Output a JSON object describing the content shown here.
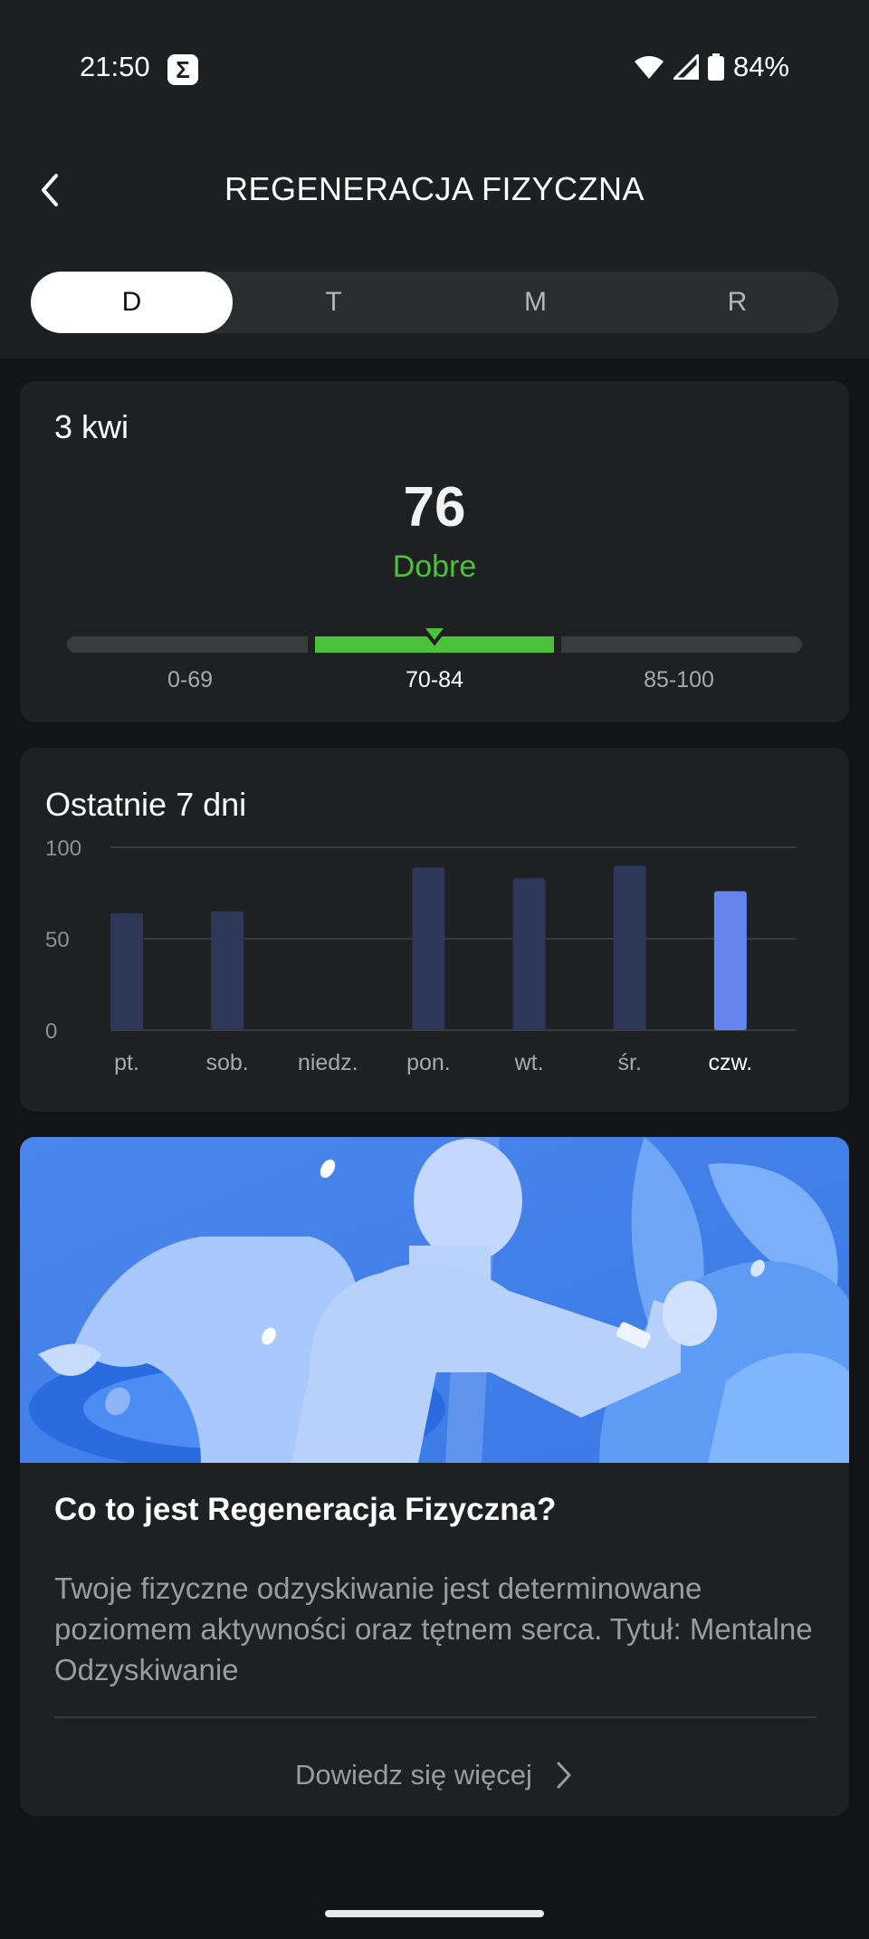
{
  "status_bar": {
    "time": "21:50",
    "app_icon": "sigma-icon",
    "battery_percent": "84%"
  },
  "header": {
    "title": "REGENERACJA FIZYCZNA",
    "back_icon": "chevron-left-icon"
  },
  "period_tabs": {
    "items": [
      {
        "label": "D",
        "active": true
      },
      {
        "label": "T",
        "active": false
      },
      {
        "label": "M",
        "active": false
      },
      {
        "label": "R",
        "active": false
      }
    ]
  },
  "score_card": {
    "date": "3 kwi",
    "score": "76",
    "rating": "Dobre",
    "rating_color": "#4cc13a",
    "ranges": [
      {
        "label": "0-69",
        "active": false
      },
      {
        "label": "70-84",
        "active": true
      },
      {
        "label": "85-100",
        "active": false
      }
    ]
  },
  "history_card": {
    "title": "Ostatnie 7 dni"
  },
  "chart_data": {
    "type": "bar",
    "title": "Ostatnie 7 dni",
    "categories": [
      "pt.",
      "sob.",
      "niedz.",
      "pon.",
      "wt.",
      "śr.",
      "czw."
    ],
    "values": [
      64,
      65,
      null,
      89,
      83,
      90,
      76
    ],
    "highlight_index": 6,
    "ylim": [
      0,
      100
    ],
    "yticks": [
      "100",
      "50",
      "0"
    ],
    "grid": true,
    "colors": {
      "bar": "#2d3757",
      "highlight": "#6485ee"
    }
  },
  "info_card": {
    "title": "Co to jest Regeneracja Fizyczna?",
    "text": "Twoje fizyczne odzyskiwanie jest determinowane poziomem aktywności oraz tętnem serca. Tytuł: Mentalne Odzyskiwanie",
    "learn_more": "Dowiedz się więcej"
  }
}
